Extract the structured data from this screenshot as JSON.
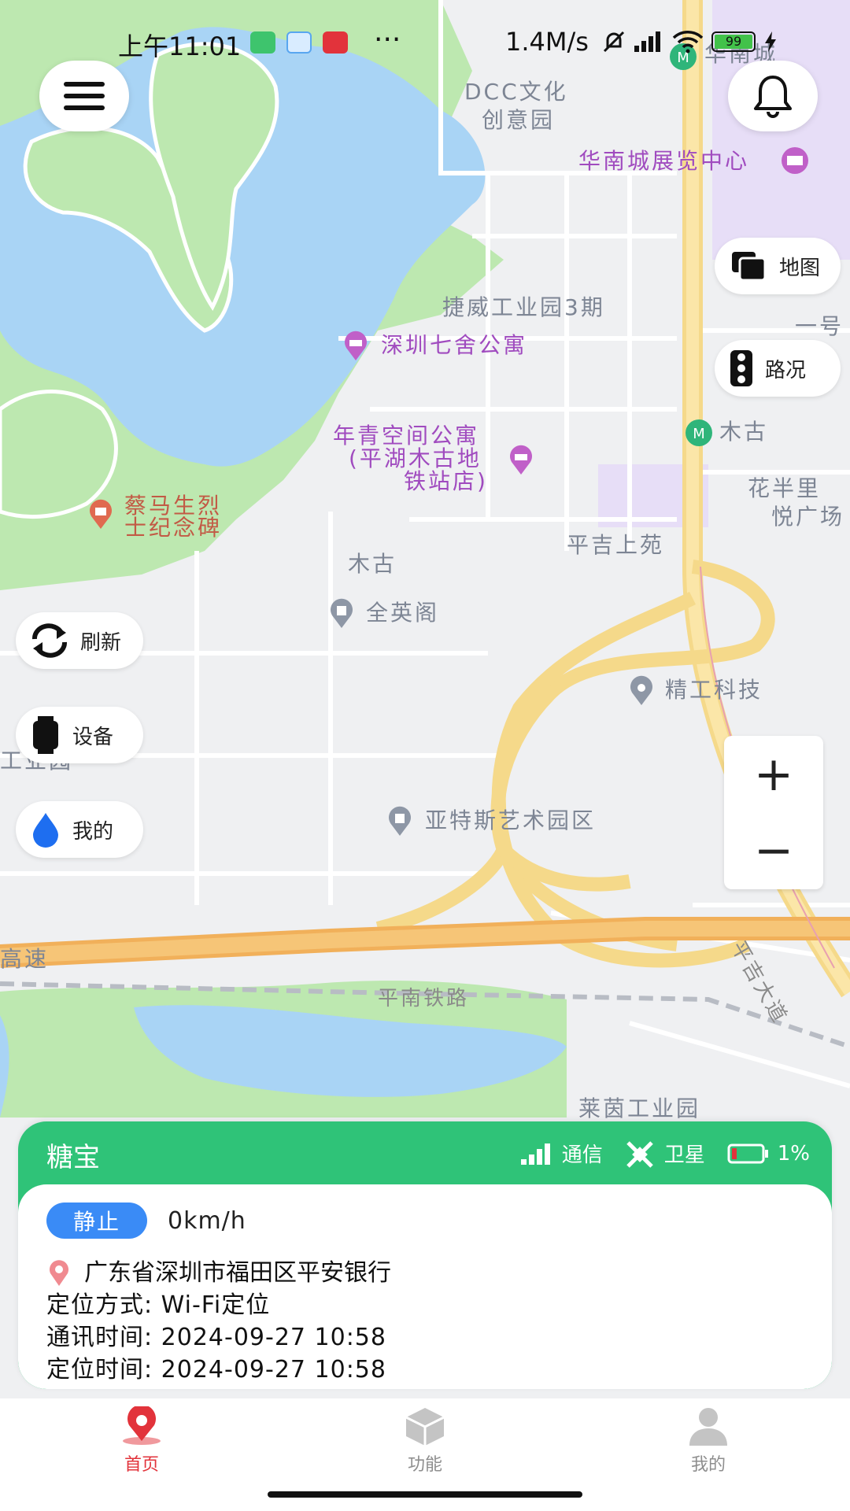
{
  "status_bar": {
    "time": "上午11:01",
    "dots": "···",
    "net_speed": "1.4M/s",
    "battery": "99"
  },
  "map_labels": [
    {
      "text": "DCC文化",
      "style": ""
    },
    {
      "text": "创意园",
      "style": ""
    },
    {
      "text": "华南城展览中心",
      "style": "purple"
    },
    {
      "text": "捷威工业园3期",
      "style": ""
    },
    {
      "text": "深圳七舍公寓",
      "style": "purple"
    },
    {
      "text": "年青空间公寓",
      "style": "purple"
    },
    {
      "text": "(平湖木古地",
      "style": "purple"
    },
    {
      "text": "铁站店)",
      "style": "purple"
    },
    {
      "text": "木古",
      "style": ""
    },
    {
      "text": "花半里",
      "style": ""
    },
    {
      "text": "悦广场",
      "style": ""
    },
    {
      "text": "平吉上苑",
      "style": ""
    },
    {
      "text": "蔡马生烈",
      "style": "brown"
    },
    {
      "text": "士纪念碑",
      "style": "brown"
    },
    {
      "text": "木古",
      "style": ""
    },
    {
      "text": "全英阁",
      "style": ""
    },
    {
      "text": "精工科技",
      "style": ""
    },
    {
      "text": "亚特斯艺术园区",
      "style": ""
    },
    {
      "text": "高速",
      "style": ""
    },
    {
      "text": "平南铁路",
      "style": "road"
    },
    {
      "text": "平吉大道",
      "style": "road"
    },
    {
      "text": "莱茵工业园",
      "style": ""
    },
    {
      "text": "华南城",
      "style": ""
    },
    {
      "text": "一号",
      "style": ""
    },
    {
      "text": "工业园",
      "style": ""
    }
  ],
  "controls": {
    "map_layer": "地图",
    "traffic": "路况",
    "refresh": "刷新",
    "device": "设备",
    "mine": "我的",
    "zoom_in": "+",
    "zoom_out": "−"
  },
  "device_card": {
    "name": "糖宝",
    "signal_label": "通信",
    "satellite_label": "卫星",
    "battery": "1%",
    "state": "静止",
    "speed": "0km/h",
    "address": "广东省深圳市福田区平安银行",
    "locate_method": "定位方式:  Wi-Fi定位",
    "comm_time": "通讯时间:  2024-09-27 10:58",
    "locate_time": "定位时间:  2024-09-27 10:58"
  },
  "tabs": [
    {
      "label": "首页",
      "active": true
    },
    {
      "label": "功能",
      "active": false
    },
    {
      "label": "我的",
      "active": false
    }
  ],
  "colors": {
    "accent_green": "#2fc378",
    "active_red": "#e2333b",
    "state_blue": "#3a8bf6"
  }
}
